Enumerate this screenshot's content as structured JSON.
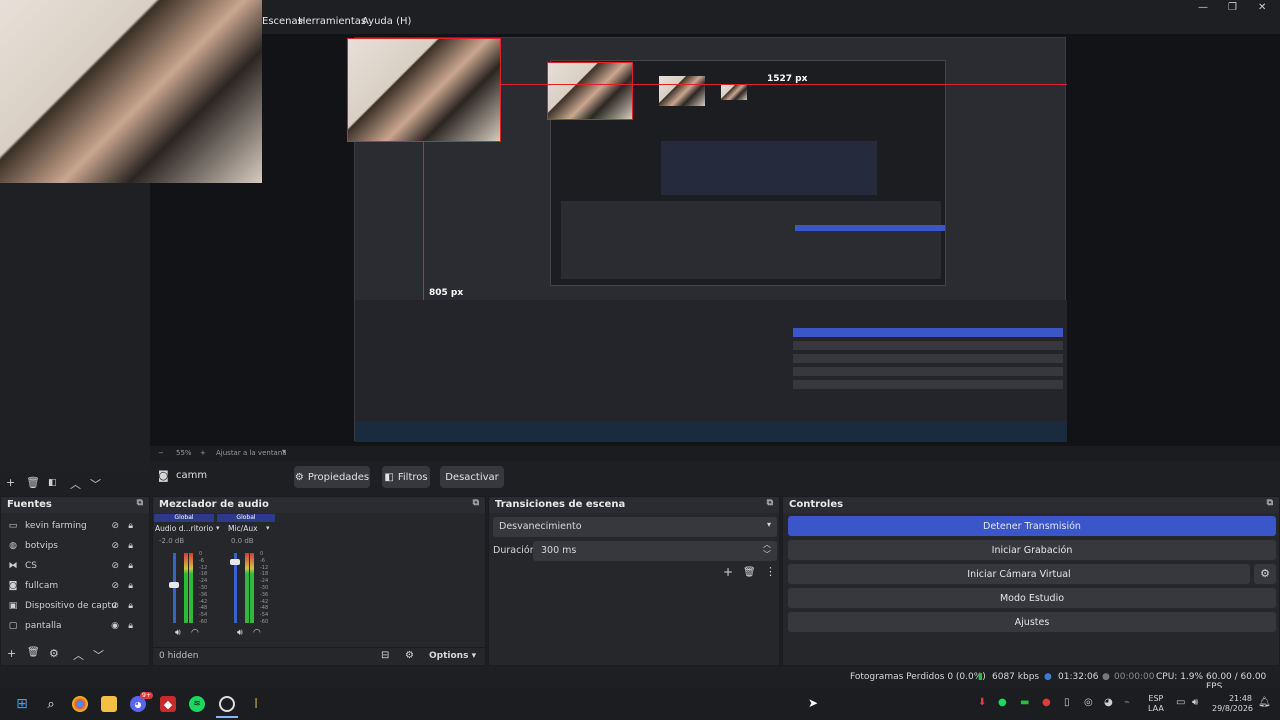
{
  "menu": {
    "items": [
      "Escenas",
      "Herramientas",
      "Ayuda (H)"
    ]
  },
  "preview": {
    "measure_top": "1527 px",
    "measure_left": "805 px"
  },
  "zoom": {
    "minus": "−",
    "value": "55%",
    "plus": "+",
    "fit": "Ajustar a la ventana"
  },
  "source_bar": {
    "name": "camm",
    "properties": "Propiedades",
    "filters": "Filtros",
    "deactivate": "Desactivar"
  },
  "sources": {
    "title": "Fuentes",
    "items": [
      {
        "label": "kevin farming",
        "icon": "window-icon"
      },
      {
        "label": "botvips",
        "icon": "globe-icon"
      },
      {
        "label": "CS",
        "icon": "gamepad-icon"
      },
      {
        "label": "fullcam",
        "icon": "camera-icon"
      },
      {
        "label": "Dispositivo de captu",
        "icon": "capture-icon"
      },
      {
        "label": "pantalla",
        "icon": "monitor-icon"
      }
    ]
  },
  "mixer": {
    "title": "Mezclador de audio",
    "channels": [
      {
        "tag": "Global",
        "name": "Audio d...ritorio",
        "db": "-2.0 dB",
        "level": 0.55
      },
      {
        "tag": "Global",
        "name": "Mic/Aux",
        "db": "0.0 dB",
        "level": 0.9
      }
    ],
    "scale": [
      "0",
      "-6",
      "-12",
      "-18",
      "-24",
      "-30",
      "-36",
      "-42",
      "-48",
      "-54",
      "-60"
    ],
    "hidden": "0 hidden",
    "options": "Options"
  },
  "transitions": {
    "title": "Transiciones de escena",
    "selected": "Desvanecimiento",
    "duration_label": "Duración",
    "duration_value": "300 ms"
  },
  "controls": {
    "title": "Controles",
    "buttons": [
      "Detener Transmisión",
      "Iniciar Grabación",
      "Iniciar Cámara Virtual",
      "Modo Estudio",
      "Ajustes"
    ]
  },
  "status": {
    "dropped": "Fotogramas Perdidos 0 (0.0%)",
    "kbps": "6087 kbps",
    "live_time": "01:32:06",
    "rec_time": "00:00:00",
    "cpu": "CPU: 1.9%",
    "fps": "60.00 / 60.00 FPS"
  },
  "taskbar": {
    "lang": "ESP",
    "lang2": "LAA",
    "time": "21:48",
    "date": "29/8/2026",
    "discord_badge": "9+"
  },
  "colors": {
    "accent": "#3a56c8",
    "guide_red": "#e0202a",
    "meter_green": "#2dbb3a"
  }
}
